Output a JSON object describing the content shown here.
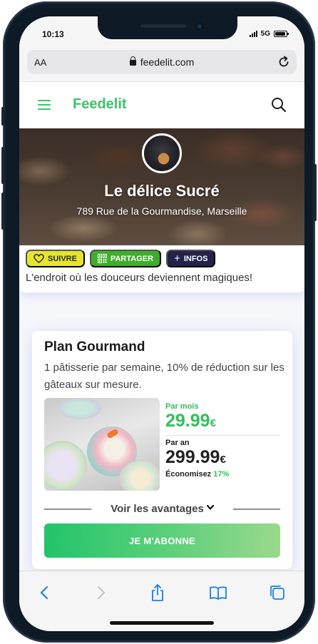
{
  "status_bar": {
    "time": "10:13",
    "network": "5G",
    "battery_level": 0.9
  },
  "browser": {
    "text_size_label": "AA",
    "url": "feedelit.com"
  },
  "nav": {
    "brand": "Feedelit"
  },
  "hero": {
    "title": "Le délice Sucré",
    "address": "789 Rue de la Gourmandise, Marseille"
  },
  "actions": {
    "follow": "SUIVRE",
    "share": "PARTAGER",
    "info": "INFOS"
  },
  "profile": {
    "tagline": "L'endroit où les douceurs deviennent magiques!"
  },
  "plan": {
    "title": "Plan Gourmand",
    "description": "1 pâtisserie par semaine, 10% de réduction sur les gâteaux sur mesure.",
    "monthly_label": "Par mois",
    "monthly_price": "29.99",
    "yearly_label": "Par an",
    "yearly_price": "299.99",
    "currency": "€",
    "savings_label": "Économisez",
    "savings_value": "17%",
    "advantages_label": "Voir les avantages",
    "subscribe_label": "JE M'ABONNE"
  },
  "colors": {
    "brand": "#3cc46a",
    "follow": "#e7e52a",
    "share": "#3fae2b",
    "info": "#22224a",
    "price_green": "#2fbf58"
  },
  "icons": [
    "hamburger-icon",
    "search-icon",
    "heart-icon",
    "qr-code-icon",
    "plus-icon",
    "lock-icon",
    "reload-icon",
    "back-icon",
    "forward-icon",
    "share-icon",
    "bookmarks-icon",
    "tabs-icon",
    "chevron-down-icon"
  ]
}
